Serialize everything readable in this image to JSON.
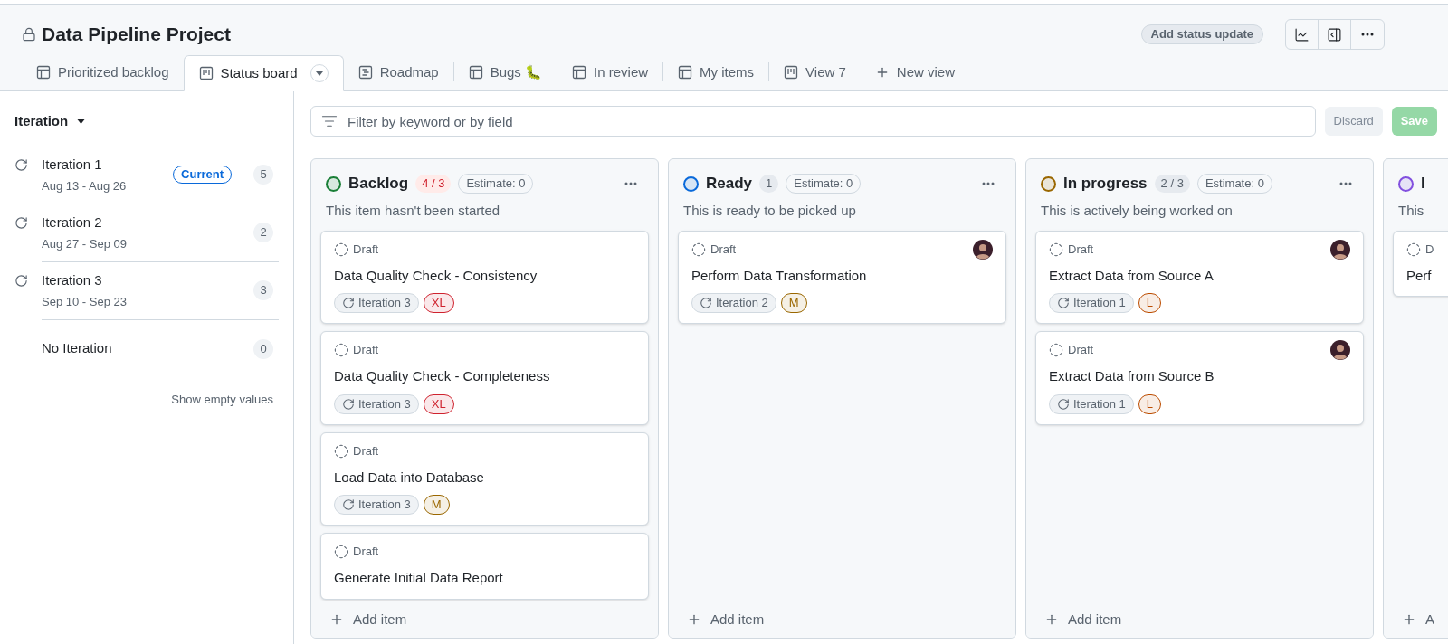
{
  "project": {
    "title": "Data Pipeline Project",
    "status_button": "Add status update"
  },
  "tabs": [
    {
      "label": "Prioritized backlog",
      "kind": "table",
      "selected": false
    },
    {
      "label": "Status board",
      "kind": "board",
      "selected": true
    },
    {
      "label": "Roadmap",
      "kind": "roadmap",
      "selected": false
    },
    {
      "label": "Bugs 🐛",
      "kind": "table",
      "selected": false
    },
    {
      "label": "In review",
      "kind": "table",
      "selected": false
    },
    {
      "label": "My items",
      "kind": "table",
      "selected": false
    },
    {
      "label": "View 7",
      "kind": "board",
      "selected": false
    }
  ],
  "new_view": "New view",
  "sidebar": {
    "heading": "Iteration",
    "items": [
      {
        "kind": "iteration",
        "name": "Iteration 1",
        "dates": "Aug 13 - Aug 26",
        "badge": "Current",
        "count": "5"
      },
      {
        "kind": "iteration",
        "name": "Iteration 2",
        "dates": "Aug 27 - Sep 09",
        "count": "2"
      },
      {
        "kind": "iteration",
        "name": "Iteration 3",
        "dates": "Sep 10 - Sep 23",
        "count": "3"
      },
      {
        "kind": "none",
        "name": "No Iteration",
        "count": "0"
      }
    ],
    "show_empty": "Show empty values"
  },
  "filter": {
    "placeholder": "Filter by keyword or by field",
    "discard": "Discard",
    "save": "Save"
  },
  "columns": [
    {
      "name": "Backlog",
      "color": "#1a7f37",
      "count": "4 / 3",
      "over_limit": true,
      "estimate": "Estimate: 0",
      "description": "This item hasn't been started",
      "add": "Add item",
      "cards": [
        {
          "status": "Draft",
          "title": "Data Quality Check - Consistency",
          "assigned": false,
          "iteration": "Iteration 3",
          "size": "XL",
          "color": "#cf222e"
        },
        {
          "status": "Draft",
          "title": "Data Quality Check - Completeness",
          "assigned": false,
          "iteration": "Iteration 3",
          "size": "XL",
          "color": "#cf222e"
        },
        {
          "status": "Draft",
          "title": "Load Data into Database",
          "assigned": false,
          "iteration": "Iteration 3",
          "size": "M",
          "color": "#9a6700"
        },
        {
          "status": "Draft",
          "title": "Generate Initial Data Report",
          "assigned": false
        }
      ]
    },
    {
      "name": "Ready",
      "color": "#0969da",
      "count": "1",
      "over_limit": false,
      "estimate": "Estimate: 0",
      "description": "This is ready to be picked up",
      "add": "Add item",
      "cards": [
        {
          "status": "Draft",
          "title": "Perform Data Transformation",
          "assigned": true,
          "iteration": "Iteration 2",
          "size": "M",
          "color": "#9a6700"
        }
      ]
    },
    {
      "name": "In progress",
      "color": "#9a6700",
      "count": "2 / 3",
      "over_limit": false,
      "estimate": "Estimate: 0",
      "description": "This is actively being worked on",
      "add": "Add item",
      "cards": [
        {
          "status": "Draft",
          "title": "Extract Data from Source A",
          "assigned": true,
          "iteration": "Iteration 1",
          "size": "L",
          "color": "#bc4c00"
        },
        {
          "status": "Draft",
          "title": "Extract Data from Source B",
          "assigned": true,
          "iteration": "Iteration 1",
          "size": "L",
          "color": "#bc4c00"
        }
      ]
    },
    {
      "name": "I",
      "color": "#8250df",
      "description": "This",
      "add": "A",
      "cards": [
        {
          "status": "D",
          "title": "Perf",
          "assigned": false
        }
      ]
    }
  ]
}
